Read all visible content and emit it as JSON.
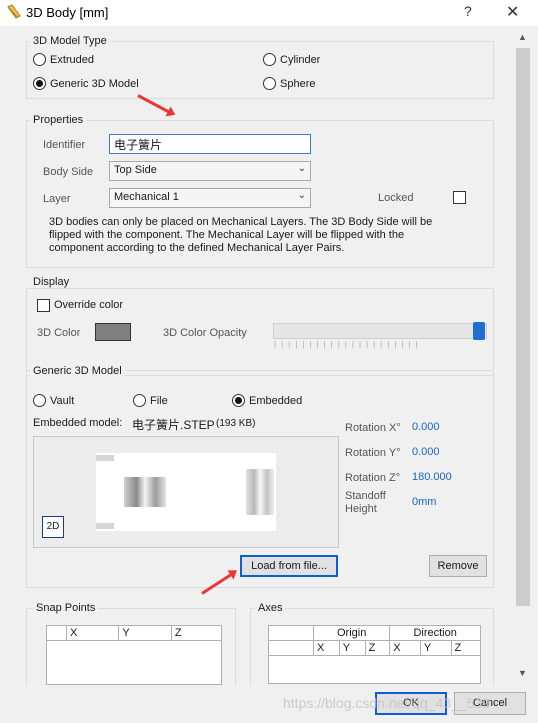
{
  "window": {
    "title": "3D Body [mm]",
    "help_glyph": "?",
    "close_glyph": "✕",
    "icon": "3d-body-icon"
  },
  "model_type": {
    "title": "3D Model Type",
    "options": [
      {
        "label": "Extruded",
        "selected": false
      },
      {
        "label": "Cylinder",
        "selected": false
      },
      {
        "label": "Generic 3D Model",
        "selected": true
      },
      {
        "label": "Sphere",
        "selected": false
      }
    ]
  },
  "properties": {
    "title": "Properties",
    "identifier_label": "Identifier",
    "identifier_value": "电子簧片",
    "body_side_label": "Body Side",
    "body_side_value": "Top Side",
    "layer_label": "Layer",
    "layer_value": "Mechanical 1",
    "locked_label": "Locked",
    "note_lines": [
      "3D bodies can only be placed on Mechanical Layers. The 3D Body Side will be",
      "flipped with the component. The Mechanical Layer will be flipped with the",
      "component according to the defined Mechanical Layer Pairs."
    ]
  },
  "display": {
    "title": "Display",
    "override_label": "Override color",
    "color_label": "3D Color",
    "color_value": "#808080",
    "opacity_label": "3D Color Opacity",
    "opacity_value": 1.0
  },
  "generic_model": {
    "title": "Generic 3D Model",
    "sources": [
      {
        "label": "Vault",
        "selected": false
      },
      {
        "label": "File",
        "selected": false
      },
      {
        "label": "Embedded",
        "selected": true
      }
    ],
    "embedded_label": "Embedded model:",
    "embedded_file": "电子簧片.STEP",
    "embedded_size": "(193 KB)",
    "view_toggle": "2D",
    "rotation_x_label": "Rotation X°",
    "rotation_x": "0.000",
    "rotation_y_label": "Rotation Y°",
    "rotation_y": "0.000",
    "rotation_z_label": "Rotation Z°",
    "rotation_z": "180.000",
    "standoff_label_1": "Standoff",
    "standoff_label_2": "Height",
    "standoff_value": "0mm",
    "load_button": "Load from file...",
    "remove_button": "Remove"
  },
  "snap_points": {
    "title": "Snap Points",
    "columns": [
      "",
      "X",
      "Y",
      "Z"
    ]
  },
  "axes": {
    "title": "Axes",
    "group_headers": [
      "Origin",
      "Direction"
    ],
    "columns": [
      "X",
      "Y",
      "Z",
      "X",
      "Y",
      "Z"
    ]
  },
  "footer": {
    "ok": "OK",
    "cancel": "Cancel"
  },
  "watermark": "https://blog.csdn.net/qq_43__539",
  "colors": {
    "accent": "#1e6fd0",
    "value_text": "#1565c0",
    "annotation_arrow": "#e53935"
  }
}
